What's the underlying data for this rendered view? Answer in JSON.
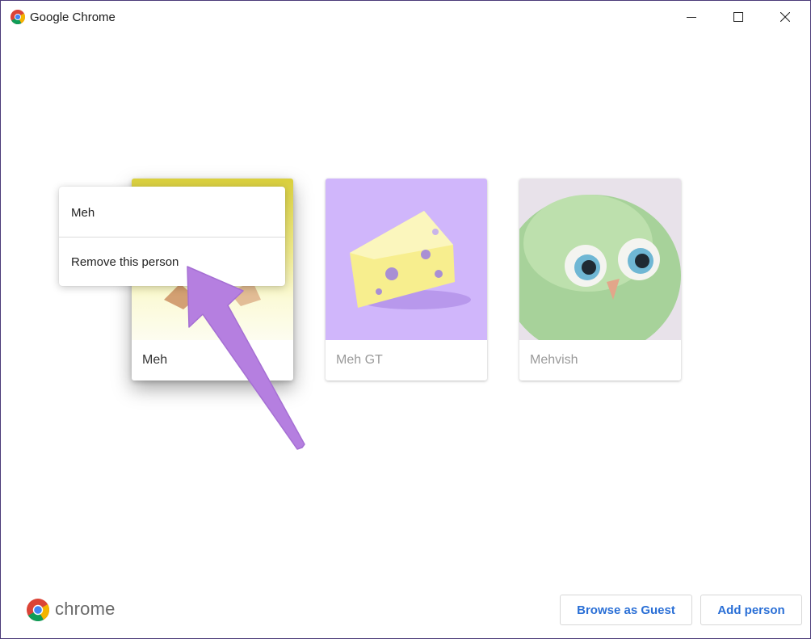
{
  "window": {
    "title": "Google Chrome"
  },
  "profiles": [
    {
      "name": "Meh",
      "selected": true,
      "avatar": "origami-avatar"
    },
    {
      "name": "Meh GT",
      "selected": false,
      "avatar": "cheese-avatar"
    },
    {
      "name": "Mehvish",
      "selected": false,
      "avatar": "fluffy-bird-avatar"
    }
  ],
  "context_menu": {
    "items": [
      {
        "label": "Meh"
      },
      {
        "label": "Remove this person"
      }
    ]
  },
  "footer": {
    "brand": "chrome",
    "browse_guest_label": "Browse as Guest",
    "add_person_label": "Add person"
  },
  "colors": {
    "accent": "#2a6fd6",
    "annotation_arrow": "#b57fe0",
    "card2_bg": "#d0b6fb",
    "window_border": "#4a3a78"
  }
}
